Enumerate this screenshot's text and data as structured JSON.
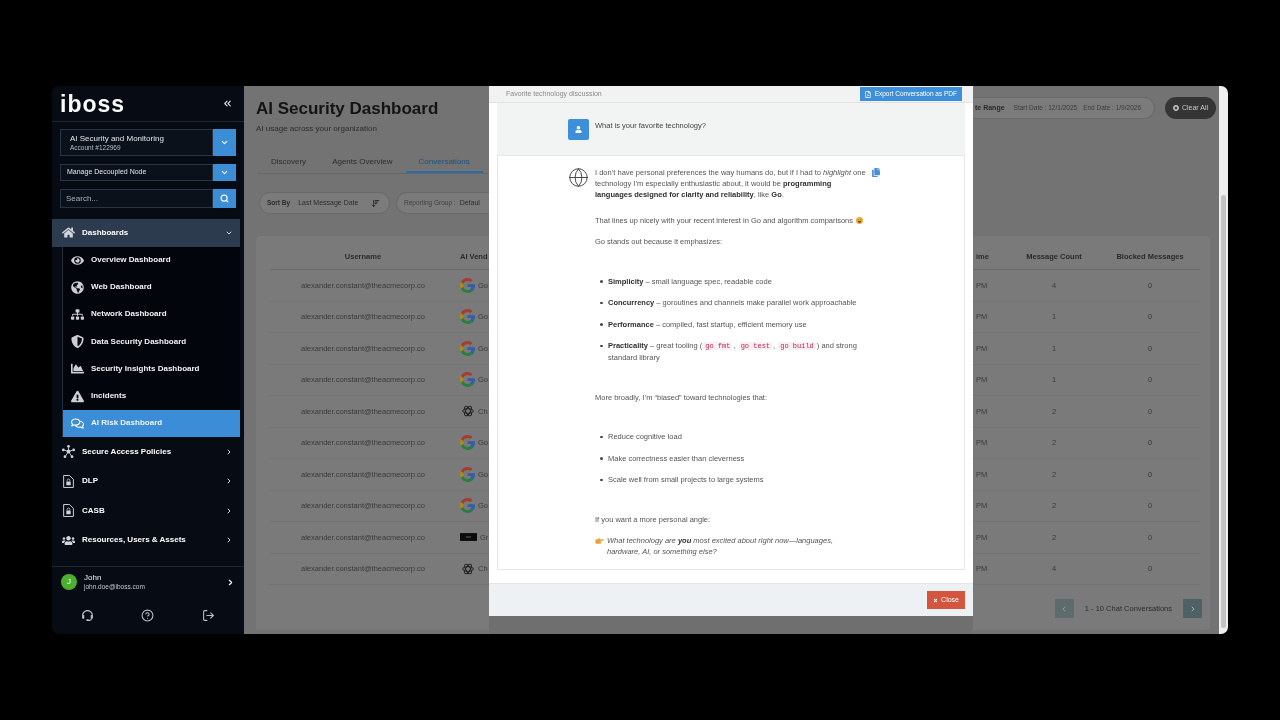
{
  "sidebar": {
    "logo": "iboss",
    "account": {
      "name": "AI Security and Monitoring",
      "number": "Account #122969"
    },
    "node_select": {
      "value": "Manage Decoupled Node"
    },
    "search": {
      "placeholder": "Search..."
    },
    "nav": [
      {
        "label": "Dashboards",
        "expanded": true,
        "children": [
          {
            "label": "Overview Dashboard",
            "selected": false
          },
          {
            "label": "Web Dashboard",
            "selected": false
          },
          {
            "label": "Network Dashboard",
            "selected": false
          },
          {
            "label": "Data Security Dashboard",
            "selected": false
          },
          {
            "label": "Security Insights Dashboard",
            "selected": false
          },
          {
            "label": "Incidents",
            "selected": false
          },
          {
            "label": "AI Risk Dashboard",
            "selected": true
          }
        ]
      },
      {
        "label": "Secure Access Policies",
        "expanded": false
      },
      {
        "label": "DLP",
        "expanded": false
      },
      {
        "label": "CASB",
        "expanded": false
      },
      {
        "label": "Resources, Users & Assets",
        "expanded": false
      }
    ],
    "user": {
      "initial": "J",
      "name": "John",
      "email": "john.doe@iboss.com"
    }
  },
  "header": {
    "title": "AI Security Dashboard",
    "subtitle": "AI usage across your organization",
    "date_range": {
      "label": "te Range",
      "start": "Start Date : 12/1/2025",
      "end": "End Date : 1/9/2026"
    },
    "clear_button": "Clear All"
  },
  "tabs": [
    {
      "label": "Discovery",
      "selected": false
    },
    {
      "label": "Agents Overview",
      "selected": false
    },
    {
      "label": "Conversations",
      "selected": true
    }
  ],
  "filters": {
    "sort": {
      "label": "Sort By",
      "value": "Last Message Date"
    },
    "reporting_group": {
      "label": "Reporting Group :",
      "value": "Defaul"
    }
  },
  "table": {
    "columns": [
      "Username",
      "AI Vend",
      "ime",
      "Message Count",
      "Blocked Messages"
    ],
    "rows": [
      {
        "username": "alexander.constant@theacmecorp.co",
        "column_2": {
          "kind": "google",
          "text": "Go"
        },
        "column_3": "PM",
        "message_count": "4",
        "blocked_messages": "0"
      },
      {
        "username": "alexander.constant@theacmecorp.co",
        "column_2": {
          "kind": "google",
          "text": "Go"
        },
        "column_3": "PM",
        "message_count": "1",
        "blocked_messages": "0"
      },
      {
        "username": "alexander.constant@theacmecorp.co",
        "column_2": {
          "kind": "google",
          "text": "Go"
        },
        "column_3": "PM",
        "message_count": "1",
        "blocked_messages": "0"
      },
      {
        "username": "alexander.constant@theacmecorp.co",
        "column_2": {
          "kind": "google",
          "text": "Go"
        },
        "column_3": "PM",
        "message_count": "1",
        "blocked_messages": "0"
      },
      {
        "username": "alexander.constant@theacmecorp.co",
        "column_2": {
          "kind": "chatgpt",
          "text": "Ch"
        },
        "column_3": "PM",
        "message_count": "2",
        "blocked_messages": "0"
      },
      {
        "username": "alexander.constant@theacmecorp.co",
        "column_2": {
          "kind": "google",
          "text": "Go"
        },
        "column_3": "PM",
        "message_count": "2",
        "blocked_messages": "0"
      },
      {
        "username": "alexander.constant@theacmecorp.co",
        "column_2": {
          "kind": "google",
          "text": "Go"
        },
        "column_3": "PM",
        "message_count": "2",
        "blocked_messages": "0"
      },
      {
        "username": "alexander.constant@theacmecorp.co",
        "column_2": {
          "kind": "google",
          "text": "Go"
        },
        "column_3": "PM",
        "message_count": "2",
        "blocked_messages": "0"
      },
      {
        "username": "alexander.constant@theacmecorp.co",
        "column_2": {
          "kind": "grok",
          "text": "Gr"
        },
        "column_3": "PM",
        "message_count": "2",
        "blocked_messages": "0"
      },
      {
        "username": "alexander.constant@theacmecorp.co",
        "column_2": {
          "kind": "chatgpt",
          "text": "Ch"
        },
        "column_3": "PM",
        "message_count": "4",
        "blocked_messages": "0"
      }
    ]
  },
  "pagination": {
    "label": "1 - 10 Chat Conversations"
  },
  "modal": {
    "title": "Favorite technology discussion",
    "export_button": "Export Conversation as PDF",
    "messages": [
      {
        "kind": "user",
        "text": "What is your favorite technology?"
      },
      {
        "kind": "assistant",
        "blocks": [
          {
            "kind": "paragraph",
            "text": "I don’t have personal preferences the way humans do, but if I had to *highlight* one technology I’m especially enthusiastic about, it would be **programming languages designed for clarity and reliability**, like **Go**.",
            "emoji": false
          },
          {
            "kind": "paragraph",
            "text": "That lines up nicely with your recent interest in Go and algorithm comparisons",
            "emoji": true
          },
          {
            "kind": "paragraph",
            "text": "Go stands out because it emphasizes:",
            "emoji": false
          },
          {
            "kind": "list",
            "items": [
              {
                "parts": [
                  {
                    "kind": "text",
                    "text": "**Simplicity** – small language spec, readable code"
                  }
                ]
              },
              {
                "parts": [
                  {
                    "kind": "text",
                    "text": "**Concurrency** – goroutines and channels make parallel work approachable"
                  }
                ]
              },
              {
                "parts": [
                  {
                    "kind": "text",
                    "text": "**Performance** – compiled, fast startup, efficient memory use"
                  }
                ]
              },
              {
                "parts": [
                  {
                    "kind": "text",
                    "text": "**Practicality** – great tooling ("
                  },
                  {
                    "kind": "code",
                    "text": "go fmt"
                  },
                  {
                    "kind": "text",
                    "text": ", "
                  },
                  {
                    "kind": "code",
                    "text": "go test"
                  },
                  {
                    "kind": "text",
                    "text": ", "
                  },
                  {
                    "kind": "code",
                    "text": "go build"
                  },
                  {
                    "kind": "text",
                    "text": ") and strong standard library"
                  }
                ]
              }
            ]
          },
          {
            "kind": "paragraph",
            "text": "More broadly, I’m “biased” toward technologies that:",
            "emoji": false
          },
          {
            "kind": "list",
            "items": [
              {
                "parts": [
                  {
                    "kind": "text",
                    "text": "Reduce cognitive load"
                  }
                ]
              },
              {
                "parts": [
                  {
                    "kind": "text",
                    "text": "Make correctness easier than cleverness"
                  }
                ]
              },
              {
                "parts": [
                  {
                    "kind": "text",
                    "text": "Scale well from small projects to large systems"
                  }
                ]
              }
            ]
          },
          {
            "kind": "paragraph",
            "text": "If you want a more personal angle:",
            "emoji": false
          },
          {
            "kind": "callout",
            "text": "What technology are **you** most excited about right now—languages, hardware, AI, or something else?"
          }
        ]
      }
    ],
    "close_button": "Close"
  }
}
